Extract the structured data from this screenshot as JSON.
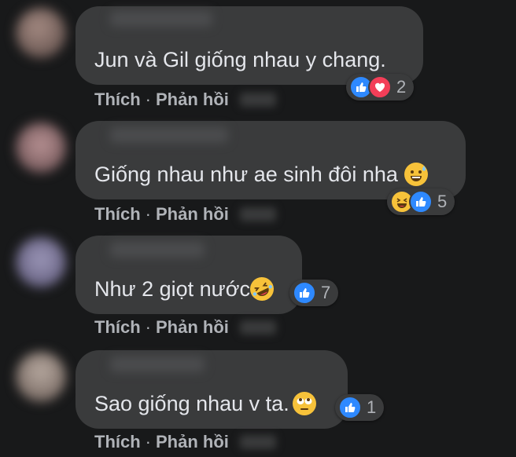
{
  "comments": [
    {
      "text": "Jun và Gil giống nhau y chang.",
      "inline_emoji": "",
      "reactions": [
        "like-icon",
        "love-icon"
      ],
      "reaction_count": "2",
      "like_label": "Thích",
      "separator": "·",
      "reply_label": "Phản hồi"
    },
    {
      "text": "Giống nhau như ae sinh đôi nha",
      "inline_emoji": "grinning-sweat-emoji",
      "reactions": [
        "haha-icon",
        "like-icon"
      ],
      "reaction_count": "5",
      "like_label": "Thích",
      "separator": "·",
      "reply_label": "Phản hồi"
    },
    {
      "text": "Như 2 giọt nước",
      "inline_emoji": "rolling-laughing-emoji",
      "reactions": [
        "like-icon"
      ],
      "reaction_count": "7",
      "like_label": "Thích",
      "separator": "·",
      "reply_label": "Phản hồi"
    },
    {
      "text": "Sao giống nhau v ta.",
      "inline_emoji": "eye-roll-emoji",
      "reactions": [
        "like-icon"
      ],
      "reaction_count": "1",
      "like_label": "Thích",
      "separator": "·",
      "reply_label": "Phản hồi"
    }
  ],
  "colors": {
    "background": "#18191a",
    "bubble": "#3a3b3c",
    "text": "#e4e6eb",
    "secondary_text": "#b0b3b8",
    "like_blue": "#2e89ff",
    "love_red": "#f33e58",
    "emoji_yellow": "#f7c23a"
  }
}
